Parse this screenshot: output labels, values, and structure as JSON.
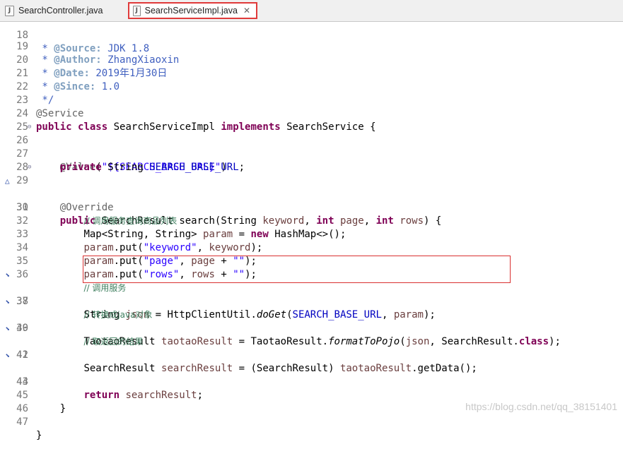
{
  "tabs": [
    {
      "label": "SearchController.java",
      "active": false
    },
    {
      "label": "SearchServiceImpl.java",
      "active": true
    }
  ],
  "line_numbers": [
    "18",
    "19",
    "20",
    "21",
    "22",
    "23",
    "24",
    "25",
    "26",
    "27",
    "28",
    "29",
    "30",
    "31",
    "32",
    "33",
    "34",
    "35",
    "36",
    "37",
    "38",
    "39",
    "40",
    "41",
    "42",
    "43",
    "44",
    "45",
    "46",
    "47"
  ],
  "text": {
    "src_label": "@Source:",
    "src_value": "JDK 1.8",
    "author_label": "@Author:",
    "author_value": "ZhangXiaoxin",
    "date_label": "@Date:",
    "date_value": "2019年1月30日",
    "since_label": "@Since:",
    "since_value": "1.0",
    "star": " *",
    "end_doc": " */",
    "ann_service": "@Service",
    "kw_public": "public",
    "kw_class": "class",
    "class_name": "SearchServiceImpl",
    "kw_implements": "implements",
    "iface": "SearchService {",
    "ann_value": "@Value",
    "value_open": "(",
    "value_str": "\"${SEARCH_BASE_URL}\"",
    "value_close": ")",
    "kw_private": "private",
    "type_string": "String",
    "field_name": "SEARCH_BASE_URL",
    "semi": ";",
    "ann_override": "@Override",
    "ret_type": "SearchResult",
    "method_sig_a": "search(String",
    "p_keyword": "keyword",
    "comma": ",",
    "kw_int": "int",
    "p_page": "page",
    "p_rows": "rows",
    "sig_end": ") {",
    "comment_31": "// 调用服务查询商品列表",
    "line32_a": "Map<String, String>",
    "v_param": "param",
    "eq": "=",
    "kw_new": "new",
    "line32_b": "HashMap<>();",
    "put_open": ".put(",
    "s_keyword": "\"keyword\"",
    "s_page": "\"page\"",
    "s_rows": "\"rows\"",
    "plus": "+",
    "s_empty": "\"\"",
    "close_semi": ");",
    "comment_36": "// 调用服务",
    "v_json": "json",
    "http_util": "HttpClientUtil.",
    "do_get": "doGet",
    "paren": "(",
    "comment_38": "// 转换成java对象",
    "type_tr": "TaotaoResult",
    "v_tr": "taotaoResult",
    "fmt": "formatToPojo",
    "sr_class": "SearchResult.",
    "kw_class2": "class",
    "comment_40": "// 取返回的结果",
    "v_sr": "searchResult",
    "cast": "(SearchResult)",
    "getdata": ".getData();",
    "kw_return": "return",
    "brace": "}"
  },
  "icons": {
    "tab_file": "java-file-icon",
    "tab_close": "close-icon",
    "fold": "collapse-icon",
    "override": "override-triangle-icon",
    "warning": "warning-marker-icon"
  },
  "watermark": "https://blog.csdn.net/qq_38151401"
}
